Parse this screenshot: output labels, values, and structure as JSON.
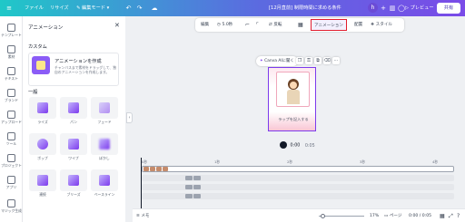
{
  "topbar": {
    "file": "ファイル",
    "resize": "リサイズ",
    "edit_mode": "編集モード",
    "doc_title": "[12月直前] 制限時間に求める条件",
    "avatar": "h",
    "preview": "プレビュー",
    "share": "共有"
  },
  "rail": {
    "items": [
      "テンプレート",
      "素材",
      "テキスト",
      "ブランド",
      "アップロード",
      "ツール",
      "プロジェクト",
      "アプリ",
      "マジック生成"
    ]
  },
  "panel": {
    "title": "アニメーション",
    "custom_label": "カスタム",
    "custom_card_title": "アニメーションを作成",
    "custom_card_desc": "チャンバスまで素材をドラッグして、独自のアニメーションを作成します。",
    "basic_label": "一般",
    "animations": [
      "ライズ",
      "パン",
      "フェード",
      "ポップ",
      "ワイプ",
      "ぼかし",
      "連続",
      "ブリーズ",
      "ベースライン"
    ]
  },
  "context_toolbar": {
    "edit": "編集",
    "duration": "5.0秒",
    "flip": "反転",
    "animate": "アニメーション",
    "position": "配置",
    "style": "スタイル"
  },
  "canvas": {
    "ai_button": "Canva AIに聞く",
    "caption": "ラップを記入する",
    "time": "0:00",
    "total": "0:05"
  },
  "timeline": {
    "ticks": [
      "0秒",
      "1秒",
      "2秒",
      "3秒",
      "4秒"
    ]
  },
  "footer": {
    "memo": "メモ",
    "zoom": "17%",
    "page": "ページ",
    "time_readout": "0:00 / 0:05"
  },
  "colors": {
    "accent": "#7c3aed",
    "highlight": "#e11d2e"
  }
}
